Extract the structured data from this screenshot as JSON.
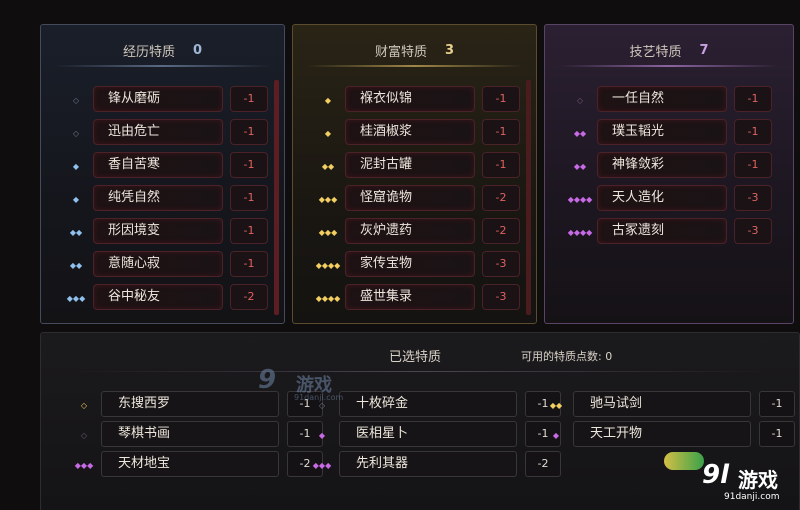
{
  "panels": {
    "experience": {
      "title": "经历特质",
      "count": "0",
      "items": [
        {
          "name": "锋从磨砺",
          "cost": "-1",
          "gem": "◇"
        },
        {
          "name": "迅由危亡",
          "cost": "-1",
          "gem": "◇"
        },
        {
          "name": "香自苦寒",
          "cost": "-1",
          "gem": "◆"
        },
        {
          "name": "纯凭自然",
          "cost": "-1",
          "gem": "◆"
        },
        {
          "name": "形因境变",
          "cost": "-1",
          "gem": "◆◆"
        },
        {
          "name": "意随心寂",
          "cost": "-1",
          "gem": "◆◆"
        },
        {
          "name": "谷中秘友",
          "cost": "-2",
          "gem": "◆◆◆"
        }
      ]
    },
    "wealth": {
      "title": "财富特质",
      "count": "3",
      "items": [
        {
          "name": "褓衣似锦",
          "cost": "-1",
          "gem": "◆"
        },
        {
          "name": "桂酒椒浆",
          "cost": "-1",
          "gem": "◆"
        },
        {
          "name": "泥封古罐",
          "cost": "-1",
          "gem": "◆◆"
        },
        {
          "name": "怪窟诡物",
          "cost": "-2",
          "gem": "◆◆◆"
        },
        {
          "name": "灰炉遗药",
          "cost": "-2",
          "gem": "◆◆◆"
        },
        {
          "name": "家传宝物",
          "cost": "-3",
          "gem": "◆◆◆◆"
        },
        {
          "name": "盛世集录",
          "cost": "-3",
          "gem": "◆◆◆◆"
        }
      ]
    },
    "skill": {
      "title": "技艺特质",
      "count": "7",
      "items": [
        {
          "name": "一任自然",
          "cost": "-1",
          "gem": "◇"
        },
        {
          "name": "璞玉韬光",
          "cost": "-1",
          "gem": "◆◆"
        },
        {
          "name": "神锋敛彩",
          "cost": "-1",
          "gem": "◆◆"
        },
        {
          "name": "天人造化",
          "cost": "-3",
          "gem": "◆◆◆◆"
        },
        {
          "name": "古冢遗刻",
          "cost": "-3",
          "gem": "◆◆◆◆"
        }
      ]
    }
  },
  "selected": {
    "title": "已选特质",
    "points_label": "可用的特质点数: 0",
    "items": [
      {
        "name": "东搜西罗",
        "cost": "-1",
        "gem": "◇"
      },
      {
        "name": "十枚碎金",
        "cost": "-1",
        "gem": "◇"
      },
      {
        "name": "驰马试剑",
        "cost": "-1",
        "gem": "◆◆"
      },
      {
        "name": "琴棋书画",
        "cost": "-1",
        "gem": "◇"
      },
      {
        "name": "医相星卜",
        "cost": "-1",
        "gem": "◆"
      },
      {
        "name": "天工开物",
        "cost": "-1",
        "gem": "◆"
      },
      {
        "name": "天材地宝",
        "cost": "-2",
        "gem": "◆◆◆"
      },
      {
        "name": "先利其器",
        "cost": "-2",
        "gem": "◆◆◆"
      }
    ]
  },
  "watermarks": {
    "center_num": "9",
    "center_text": "游戏",
    "center_url": "91danji.com",
    "corner_num": "9l",
    "corner_text": "游戏",
    "corner_url": "91danji.com"
  },
  "colors": {
    "experience": "#8fc0ee",
    "wealth": "#f3cf62",
    "skill": "#c86ae6",
    "cost_red": "#e06262"
  }
}
